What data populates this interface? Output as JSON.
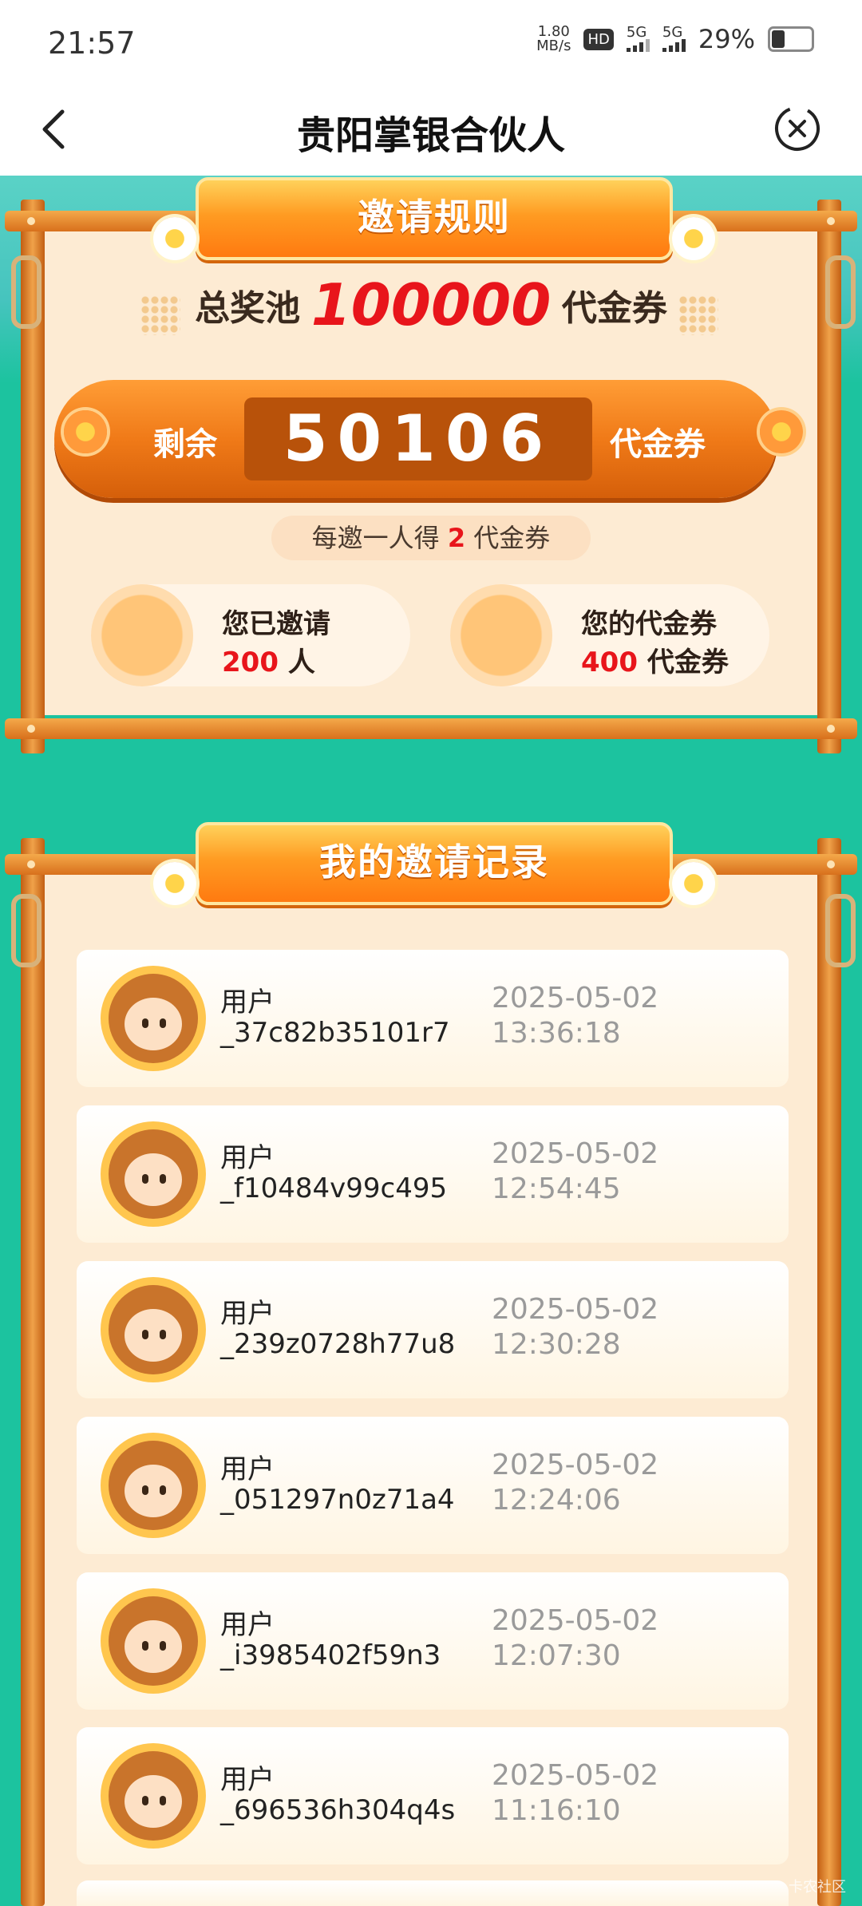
{
  "status": {
    "time": "21:57",
    "net_speed": "1.80",
    "net_unit": "MB/s",
    "hd": "HD",
    "sim1": "5G",
    "sim2": "5G",
    "battery": "29%"
  },
  "nav": {
    "title": "贵阳掌银合伙人"
  },
  "rules": {
    "banner": "邀请规则",
    "pool_prefix": "总奖池",
    "pool_amount": "100000",
    "pool_suffix": "代金券",
    "remain_label": "剩余",
    "remain_value": "50106",
    "remain_unit": "代金券",
    "per_invite_prefix": "每邀一人得",
    "per_invite_value": "2",
    "per_invite_suffix": "代金券",
    "invited_label": "您已邀请",
    "invited_value": "200",
    "invited_unit": "人",
    "coupons_label": "您的代金券",
    "coupons_value": "400",
    "coupons_unit": "代金券"
  },
  "records": {
    "banner": "我的邀请记录",
    "items": [
      {
        "label": "用户",
        "id": "_37c82b35101r7",
        "date": "2025-05-02",
        "time": "13:36:18"
      },
      {
        "label": "用户",
        "id": "_f10484v99c495",
        "date": "2025-05-02",
        "time": "12:54:45"
      },
      {
        "label": "用户",
        "id": "_239z0728h77u8",
        "date": "2025-05-02",
        "time": "12:30:28"
      },
      {
        "label": "用户",
        "id": "_051297n0z71a4",
        "date": "2025-05-02",
        "time": "12:24:06"
      },
      {
        "label": "用户",
        "id": "_i3985402f59n3",
        "date": "2025-05-02",
        "time": "12:07:30"
      },
      {
        "label": "用户",
        "id": "_696536h304q4s",
        "date": "2025-05-02",
        "time": "11:16:10"
      }
    ]
  },
  "watermark": "卡农社区"
}
